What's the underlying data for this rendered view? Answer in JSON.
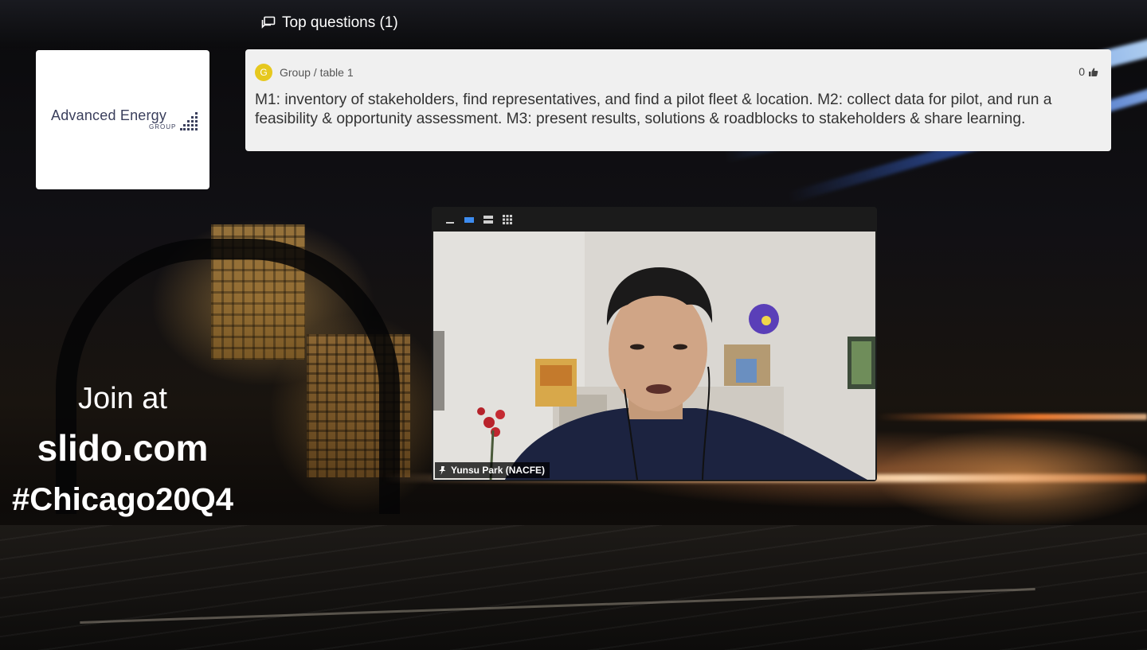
{
  "top_questions": {
    "title": "Top questions (1)"
  },
  "logo": {
    "name": "Advanced Energy",
    "sub": "GROUP"
  },
  "question": {
    "avatar_letter": "G",
    "author": "Group / table 1",
    "likes": "0",
    "text": "M1: inventory of stakeholders, find representatives, and find a pilot fleet & location. M2: collect data for pilot, and run a feasibility & opportunity assessment. M3: present results, solutions & roadblocks to stakeholders & share learning."
  },
  "join": {
    "label": "Join at",
    "site": "slido.com",
    "hashtag": "#Chicago20Q4"
  },
  "video": {
    "participant_name": "Yunsu Park (NACFE)",
    "toolbar_icons": [
      "minimize-icon",
      "speaker-view-icon",
      "stacked-view-icon",
      "gallery-view-icon"
    ]
  },
  "colors": {
    "avatar": "#e6c81e",
    "card_bg": "#f0f0f0",
    "active_view": "#3d8cf0"
  }
}
